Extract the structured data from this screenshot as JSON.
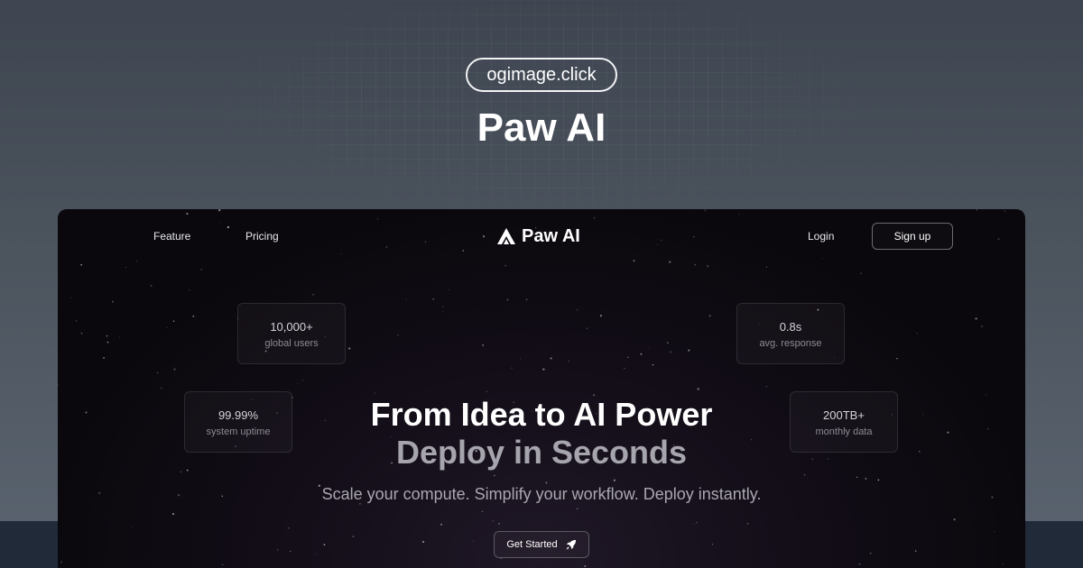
{
  "badge": {
    "label": "ogimage.click"
  },
  "headline": {
    "text": "Paw AI"
  },
  "app": {
    "nav": {
      "links": [
        "Feature",
        "Pricing"
      ],
      "brand": "Paw AI",
      "login": "Login",
      "signup": "Sign up"
    },
    "stats": [
      {
        "value": "10,000+",
        "label": "global users"
      },
      {
        "value": "0.8s",
        "label": "avg. response"
      },
      {
        "value": "99.99%",
        "label": "system uptime"
      },
      {
        "value": "200TB+",
        "label": "monthly data"
      }
    ],
    "hero": {
      "line1": "From Idea to AI Power",
      "line2": "Deploy in Seconds",
      "subline": "Scale your compute. Simplify your workflow. Deploy instantly."
    },
    "cta": {
      "label": "Get Started",
      "icon": "rocket-icon"
    }
  },
  "colors": {
    "background": "#4a525c",
    "window": "#0a080c",
    "accent_text": "#ffffff",
    "muted_text": "#a6a4ac"
  }
}
